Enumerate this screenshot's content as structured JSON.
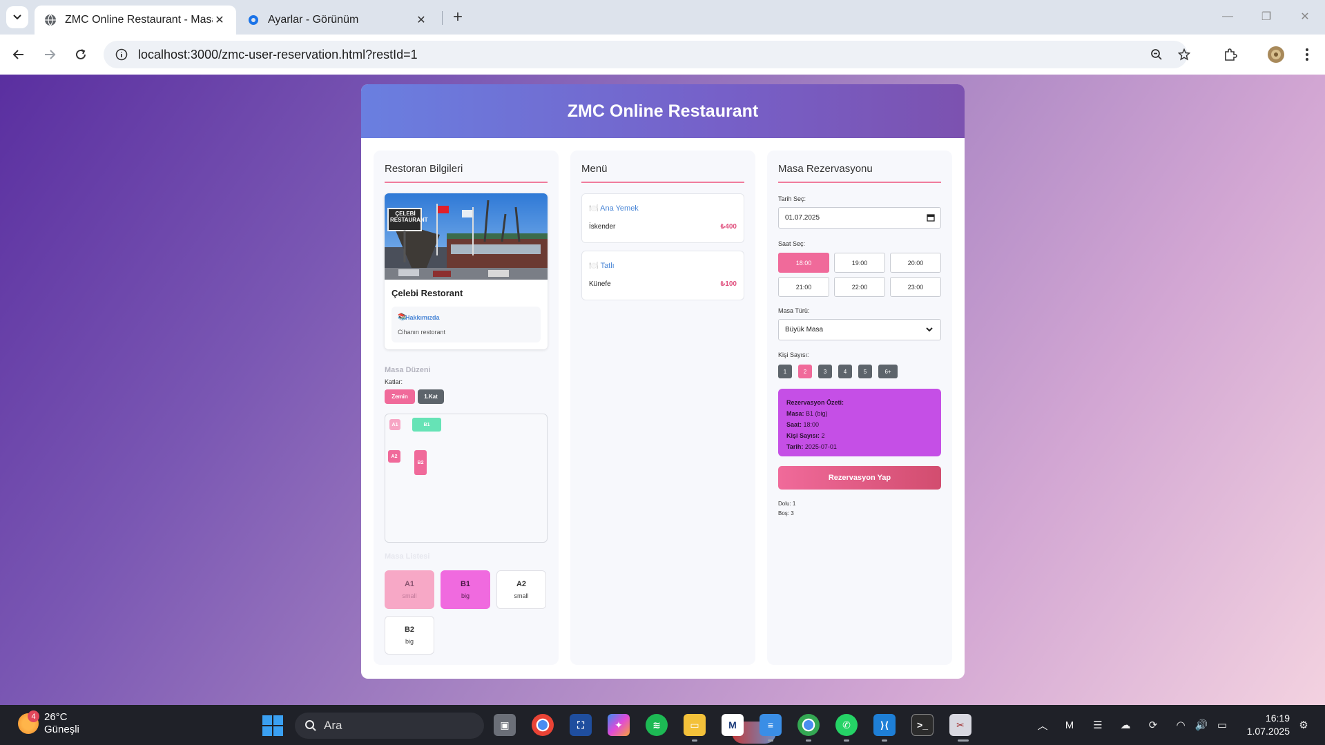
{
  "browser": {
    "tabs": [
      {
        "title": "ZMC Online Restaurant - Masa Rezervasyonu",
        "active": true
      },
      {
        "title": "Ayarlar - Görünüm",
        "active": false
      }
    ],
    "url": "localhost:3000/zmc-user-reservation.html?restId=1"
  },
  "app": {
    "title": "ZMC Online Restaurant",
    "restaurant": {
      "section_title": "Restoran Bilgileri",
      "name": "Çelebi Restorant",
      "about_title": "Hakkımızda",
      "about_text": "Cihanın restorant",
      "photo_sign": "ÇELEBİ RESTAURANT"
    },
    "layout": {
      "section_title": "Masa Düzeni",
      "floors_label": "Katlar:",
      "floors": [
        "Zemin",
        "1.Kat"
      ],
      "map_tables": [
        {
          "name": "A1",
          "color": "#f7a5c4"
        },
        {
          "name": "B1",
          "color": "#66e3b6"
        },
        {
          "name": "A2",
          "color": "#f06a9a"
        },
        {
          "name": "B2",
          "color": "#f06a9a"
        }
      ]
    },
    "table_list": {
      "section_title": "Masa Listesi",
      "tables": [
        {
          "name": "A1",
          "size": "small",
          "state": "occupied"
        },
        {
          "name": "B1",
          "size": "big",
          "state": "selected"
        },
        {
          "name": "A2",
          "size": "small",
          "state": "free"
        },
        {
          "name": "B2",
          "size": "big",
          "state": "free"
        }
      ]
    },
    "menu": {
      "section_title": "Menü",
      "categories": [
        {
          "name": "Ana Yemek",
          "item": "İskender",
          "price": "₺400"
        },
        {
          "name": "Tatlı",
          "item": "Künefe",
          "price": "₺100"
        }
      ]
    },
    "reservation": {
      "section_title": "Masa Rezervasyonu",
      "date_label": "Tarih Seç:",
      "date_value": "01.07.2025",
      "time_label": "Saat Seç:",
      "times": [
        "18:00",
        "19:00",
        "20:00",
        "21:00",
        "22:00",
        "23:00"
      ],
      "selected_time": "18:00",
      "table_type_label": "Masa Türü:",
      "table_type_value": "Büyük Masa",
      "people_label": "Kişi Sayısı:",
      "people": [
        "1",
        "2",
        "3",
        "4",
        "5",
        "6+"
      ],
      "selected_people": "2",
      "summary": {
        "title": "Rezervasyon Özeti:",
        "masa_label": "Masa:",
        "masa_value": "B1 (big)",
        "saat_label": "Saat:",
        "saat_value": "18:00",
        "kisi_label": "Kişi Sayısı:",
        "kisi_value": "2",
        "tarih_label": "Tarih:",
        "tarih_value": "2025-07-01"
      },
      "submit_label": "Rezervasyon Yap",
      "dolu": "Dolu: 1",
      "bos": "Boş: 3"
    }
  },
  "taskbar": {
    "weather_temp": "26°C",
    "weather_desc": "Güneşli",
    "weather_badge": "4",
    "search_placeholder": "Ara",
    "time": "16:19",
    "date": "1.07.2025"
  }
}
